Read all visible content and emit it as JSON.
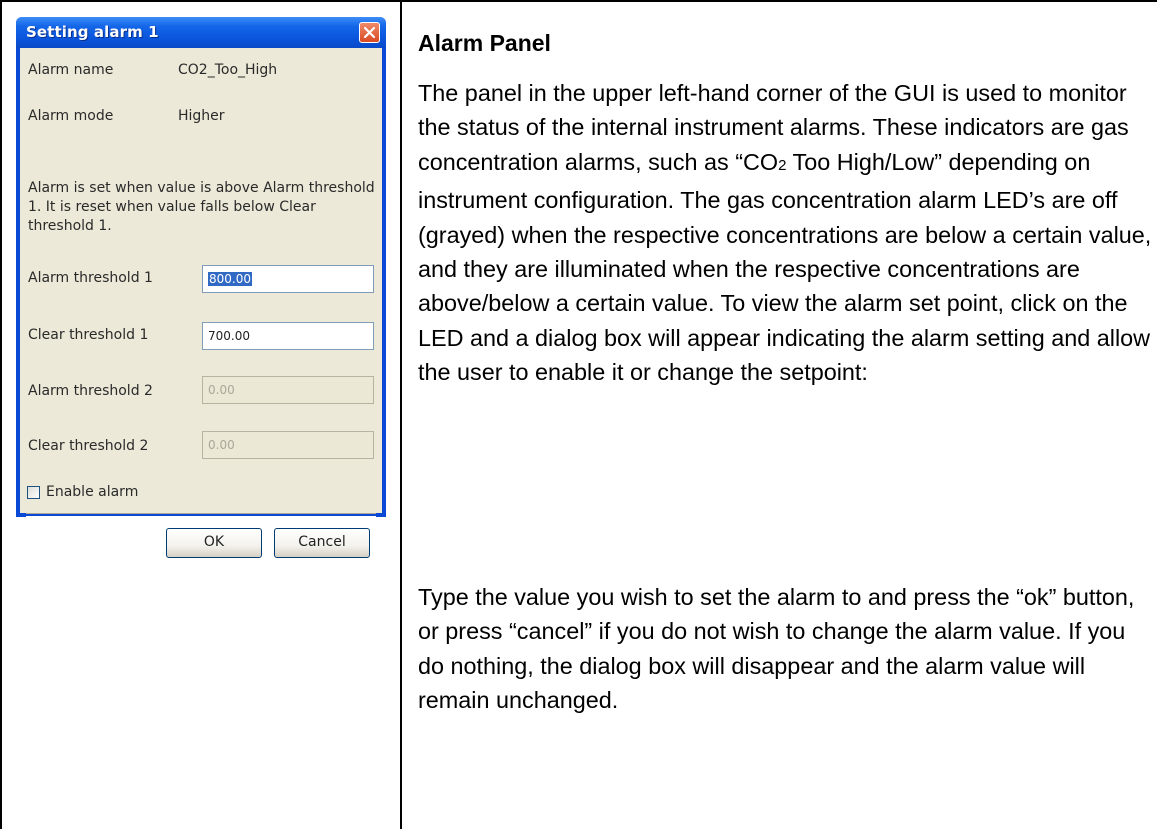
{
  "dialog": {
    "title": "Setting alarm 1",
    "alarm_name_label": "Alarm name",
    "alarm_name_value": "CO2_Too_High",
    "alarm_mode_label": "Alarm mode",
    "alarm_mode_value": "Higher",
    "description": "Alarm is set when value is above Alarm threshold 1. It is reset when value falls below Clear threshold 1.",
    "alarm_threshold_1_label": "Alarm threshold 1",
    "alarm_threshold_1_value": "800.00",
    "clear_threshold_1_label": "Clear threshold 1",
    "clear_threshold_1_value": "700.00",
    "alarm_threshold_2_label": "Alarm threshold 2",
    "alarm_threshold_2_value": "0.00",
    "clear_threshold_2_label": "Clear threshold 2",
    "clear_threshold_2_value": "0.00",
    "enable_alarm_label": "Enable alarm",
    "enable_alarm_checked": false,
    "ok_label": "OK",
    "cancel_label": "Cancel"
  },
  "doc": {
    "heading": "Alarm Panel",
    "para1_before": "The panel in the upper left-hand corner of the GUI is used to monitor the status of the internal instrument alarms.  These indicators are gas concentration alarms, such as “CO",
    "para1_sub": "2",
    "para1_after": " Too High/Low” depending on instrument configuration. The gas concentration alarm LED’s are off (grayed) when the respective concentrations are below a certain value, and they are illuminated when the respective concentrations are above/below a certain value.  To view the alarm set point, click on the LED and a dialog box will appear indicating the alarm setting and allow the user to enable it or change the setpoint:",
    "para2": "Type the value you wish to set the alarm to and press the “ok” button, or press “cancel” if you do not wish to change the alarm value.  If you do nothing, the dialog box will disappear and the alarm value will remain unchanged."
  },
  "colors": {
    "titlebar": "#0a55dc",
    "dialog_face": "#ece9d8",
    "selection": "#316ac5"
  }
}
